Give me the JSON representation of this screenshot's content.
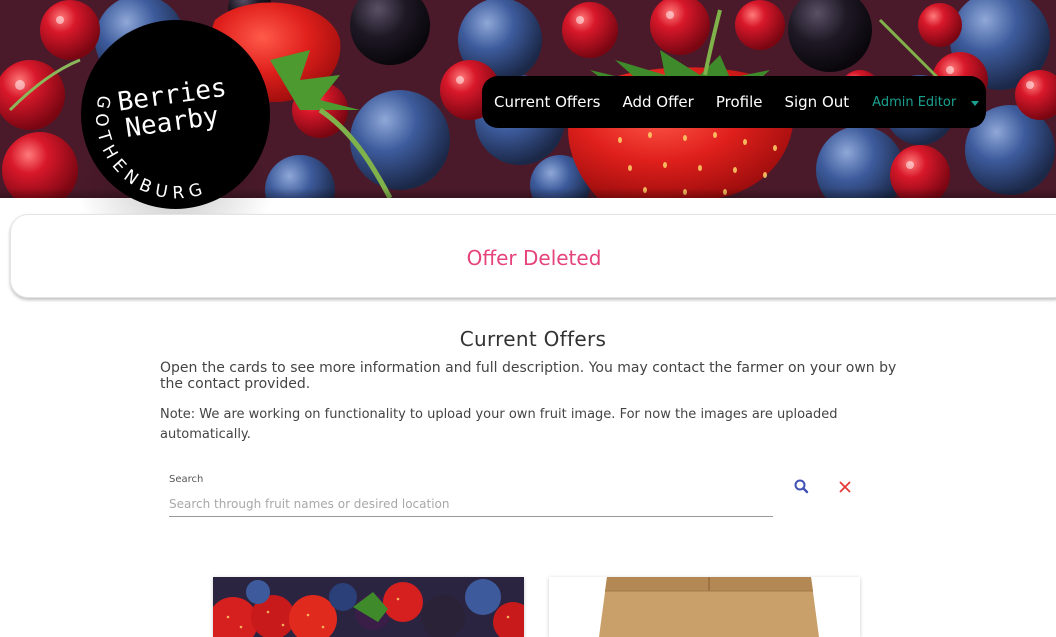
{
  "brand": {
    "title_line1": "Berries",
    "title_line2": "Nearby",
    "city": "GOTHENBURG"
  },
  "nav": {
    "items": [
      {
        "label": "Current Offers"
      },
      {
        "label": "Add Offer"
      },
      {
        "label": "Profile"
      },
      {
        "label": "Sign Out"
      }
    ],
    "user": {
      "label": "Admin Editor",
      "icon": "caret-down-icon"
    }
  },
  "alert": {
    "message": "Offer Deleted",
    "color": "#e4437c"
  },
  "main": {
    "title": "Current Offers",
    "intro": "Open the cards to see more information and full description. You may contact the farmer on your own by the contact provided.",
    "note": "Note: We are working on functionality to upload your own fruit image. For now the images are uploaded automatically."
  },
  "search": {
    "label": "Search",
    "placeholder": "Search through fruit names or desired location",
    "value": "",
    "search_icon": "search-icon",
    "clear_icon": "close-icon",
    "search_icon_color": "#3f51b5",
    "clear_icon_color": "#e53935"
  },
  "cards": [
    {
      "image": "mixed-berries-image"
    },
    {
      "image": "cardboard-box-image"
    }
  ]
}
